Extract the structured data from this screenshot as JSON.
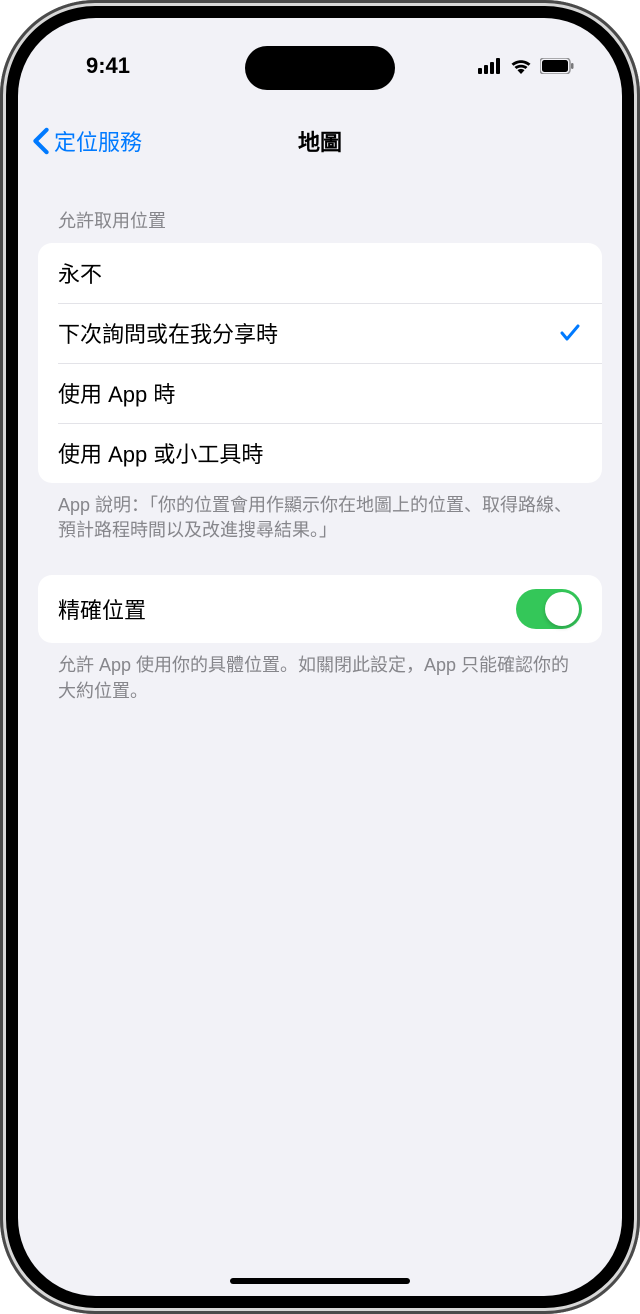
{
  "statusBar": {
    "time": "9:41"
  },
  "nav": {
    "back": "定位服務",
    "title": "地圖"
  },
  "locationAccess": {
    "header": "允許取用位置",
    "options": [
      {
        "label": "永不",
        "selected": false
      },
      {
        "label": "下次詢問或在我分享時",
        "selected": true
      },
      {
        "label": "使用 App 時",
        "selected": false
      },
      {
        "label": "使用 App 或小工具時",
        "selected": false
      }
    ],
    "footer": "App 說明：「你的位置會用作顯示你在地圖上的位置、取得路線、預計路程時間以及改進搜尋結果。」"
  },
  "preciseLocation": {
    "label": "精確位置",
    "enabled": true,
    "footer": "允許 App 使用你的具體位置。如關閉此設定，App 只能確認你的大約位置。"
  }
}
